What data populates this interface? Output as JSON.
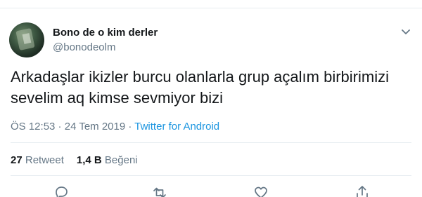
{
  "tweet": {
    "author_name": "Bono de o kim derler",
    "author_handle": "@bonodeolm",
    "text_line1": "Arkadaşlar ikizler burcu olanlarla grup açalım birbirimizi",
    "text_line2": "sevelim aq kimse sevmiyor bizi",
    "time": "ÖS 12:53",
    "sep1": " · ",
    "date": "24 Tem 2019",
    "sep2": " · ",
    "source": "Twitter for Android",
    "retweet_count": "27",
    "retweet_label": "Retweet",
    "like_count": "1,4 B",
    "like_label": "Beğeni"
  },
  "icons": {
    "menu": "chevron-down-icon",
    "reply": "reply-icon",
    "retweet": "retweet-icon",
    "like": "heart-icon",
    "share": "share-icon"
  },
  "colors": {
    "text": "#14171a",
    "secondary": "#657786",
    "link": "#1b95e0",
    "divider": "#e6ecf0"
  }
}
